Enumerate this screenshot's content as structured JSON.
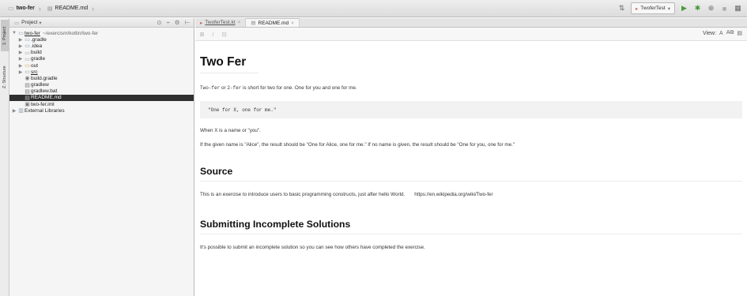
{
  "navbar": {
    "crumbs": [
      {
        "label": "two-fer",
        "icon": "folder-icon"
      },
      {
        "label": "README.md",
        "icon": "markdown-file-icon"
      }
    ],
    "run_config": "TwoferTest"
  },
  "tool_strip": {
    "tabs": [
      "1: Project",
      "Z: Structure"
    ]
  },
  "project": {
    "header_label": "Project",
    "tree": [
      {
        "label": "two-fer",
        "path": "~/exercism/kotlin/two-fer",
        "icon": "folder-icon",
        "level": 0,
        "expanded": true
      },
      {
        "label": ".gradle",
        "icon": "folder-icon",
        "level": 1,
        "expanded": false
      },
      {
        "label": ".idea",
        "icon": "folder-icon",
        "level": 1,
        "expanded": false
      },
      {
        "label": "build",
        "icon": "folder-icon",
        "level": 1,
        "expanded": false
      },
      {
        "label": "gradle",
        "icon": "folder-icon",
        "level": 1,
        "expanded": false
      },
      {
        "label": "out",
        "icon": "folder-icon",
        "level": 1,
        "expanded": false
      },
      {
        "label": "src",
        "icon": "folder-icon",
        "level": 1,
        "expanded": false
      },
      {
        "label": "build.gradle",
        "icon": "gradle-file-icon",
        "level": 1
      },
      {
        "label": "gradlew",
        "icon": "file-icon",
        "level": 1
      },
      {
        "label": "gradlew.bat",
        "icon": "file-icon",
        "level": 1
      },
      {
        "label": "README.md",
        "icon": "markdown-file-icon",
        "level": 1,
        "selected": true
      },
      {
        "label": "two-fer.iml",
        "icon": "iml-file-icon",
        "level": 1
      },
      {
        "label": "External Libraries",
        "icon": "library-icon",
        "level": 0,
        "expanded": false
      }
    ]
  },
  "editor": {
    "tabs": [
      {
        "label": "TwoferTest.kt",
        "active": false
      },
      {
        "label": "README.md",
        "active": true
      }
    ],
    "view_label": "View:"
  },
  "markdown": {
    "h1": "Two Fer",
    "p1_code1": "Two-fer",
    "p1_or": " or ",
    "p1_code2": "2-fer",
    "p1_rest": " is short for two for one. One for you and one for me.",
    "codeblock": "\"One for X, one for me.\"",
    "p2": "When X is a name or \"you\".",
    "p3": "If the given name is \"Alice\", the result should be \"One for Alice, one for me.\" If no name is given, the result should be \"One for you, one for me.\"",
    "h2_source": "Source",
    "p4": "This is an exercise to introduce users to basic programming constructs, just after hello World.",
    "p4_link": "https://en.wikipedia.org/wiki/Two-fer",
    "h2_submit": "Submitting Incomplete Solutions",
    "p5": "It's possible to submit an incomplete solution so you can see how others have completed the exercise."
  }
}
